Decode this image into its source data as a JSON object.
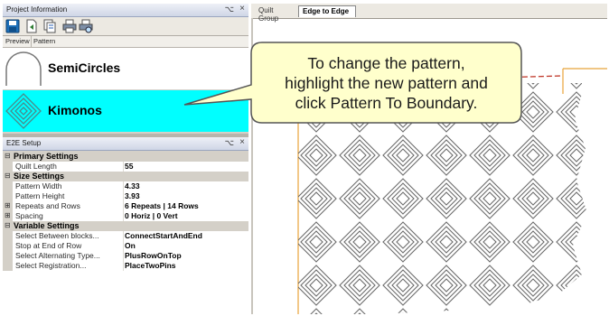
{
  "left_panel": {
    "project_title": "Project Information",
    "e2e_title": "E2E Setup",
    "pin_glyph": "⌥",
    "close_glyph": "×",
    "toolbar_icons": [
      "save-icon",
      "open-document-icon",
      "copy-document-icon",
      "print-icon",
      "print-preview-icon"
    ],
    "columns": {
      "preview": "Preview",
      "pattern": "Pattern"
    },
    "patterns": [
      {
        "name": "SemiCircles",
        "selected": false
      },
      {
        "name": "Kimonos",
        "selected": true
      }
    ],
    "colors": {
      "selection": "#00ffff",
      "panel": "#d4d0c8"
    }
  },
  "property_grid": {
    "rows": [
      {
        "type": "category",
        "expander": "⊟",
        "label": "Primary Settings"
      },
      {
        "type": "prop",
        "label": "Quilt Length",
        "value": "55"
      },
      {
        "type": "category",
        "expander": "⊟",
        "label": "Size Settings"
      },
      {
        "type": "prop",
        "label": "Pattern Width",
        "value": "4.33"
      },
      {
        "type": "prop",
        "label": "Pattern Height",
        "value": "3.93"
      },
      {
        "type": "prop",
        "expander": "⊞",
        "label": "Repeats and Rows",
        "value": "6 Repeats | 14 Rows"
      },
      {
        "type": "prop",
        "expander": "⊞",
        "label": "Spacing",
        "value": "0 Horiz | 0 Vert"
      },
      {
        "type": "category",
        "expander": "⊟",
        "label": "Variable Settings"
      },
      {
        "type": "prop",
        "label": "Select Between blocks...",
        "value": "ConnectStartAndEnd"
      },
      {
        "type": "prop",
        "label": "Stop at End of Row",
        "value": "On"
      },
      {
        "type": "prop",
        "label": "Select Alternating Type...",
        "value": "PlusRowOnTop"
      },
      {
        "type": "prop",
        "label": "Select Registration...",
        "value": "PlaceTwoPins"
      }
    ]
  },
  "view": {
    "tabs": [
      {
        "label": "Quilt Group",
        "active": false
      },
      {
        "label": "Edge to Edge",
        "active": true
      }
    ]
  },
  "callout": {
    "text_lines": [
      "To change the pattern,",
      "highlight the new pattern and",
      "click Pattern To Boundary."
    ],
    "fill": "#ffffcc",
    "border": "#555555"
  }
}
